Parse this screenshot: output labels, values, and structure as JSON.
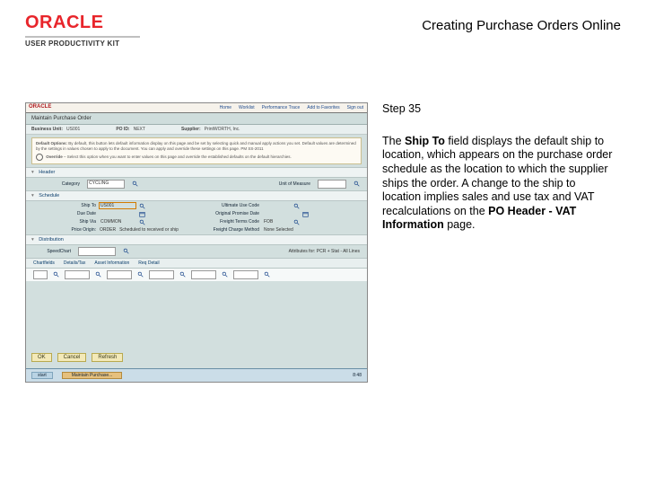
{
  "logo": {
    "brand": "ORACLE",
    "subline": "USER PRODUCTIVITY KIT"
  },
  "doc_title": "Creating Purchase Orders Online",
  "step_label": "Step 35",
  "explanation": {
    "pre": "The ",
    "bold1": "Ship To",
    "mid": " field displays the default ship to location, which appears on the purchase order schedule as the location to which the supplier ships the order. A change to the ship to location implies sales and use tax and VAT recalculations on the ",
    "bold2": "PO Header - VAT Information",
    "post": " page."
  },
  "screenshot": {
    "nav": [
      "Home",
      "Worklist",
      "Performance Trace",
      "Add to Favorites",
      "Sign out"
    ],
    "page_title": "Maintain Purchase Order",
    "info": {
      "bu_label": "Business Unit:",
      "bu_val": "US001",
      "po_label": "PO ID:",
      "po_val": "NEXT",
      "supplier_label": "Supplier:",
      "supplier_val": "PrintWORTH, Inc."
    },
    "note_title": "Default Options:",
    "note_body": "By default, this button lets default information display on this page and be set by selecting quick and manual apply actions you set. Default values are determined by the settings in values chosen to apply to the document. You can apply and override these settings on this page.\nPM SS-2011",
    "note_override": "Override",
    "note_override_body": " – Select this option when you want to enter values on this page and override the established defaults on the default hierarchies.",
    "sections": {
      "header": "Header",
      "schedule": "Schedule",
      "distribution": "Distribution"
    },
    "header_fields": {
      "category_label": "Category",
      "category_val": "CYCLING",
      "uom_label": "Unit of Measure"
    },
    "schedule_fields": {
      "shipto_label": "Ship To",
      "shipto_val": "US001",
      "distrib_label": "Ultimate Use Code",
      "duedate_label": "Due Date",
      "duedate_val": "",
      "pricedate_label": "Original Promise Date",
      "shipvia_label": "Ship Via",
      "shipvia_val": "COMMON",
      "freightcode_label": "Freight Terms Code",
      "freightcode_val": "FOB",
      "origin_label": "Price Origin:",
      "origin_val": "ORDER",
      "origin_hint": "Scheduled to received or ship",
      "process_label": "Freight Charge Method",
      "process_val": "None Selected"
    },
    "distribution_fields": {
      "speed_label": "SpeedChart",
      "right_label": "Attributes for: PCR + Stat - All Lines"
    },
    "grid": {
      "tabs": [
        "Chartfields",
        "Details/Tax",
        "Asset Information",
        "Req Detail"
      ],
      "icons": 7
    },
    "buttons": {
      "ok": "OK",
      "cancel": "Cancel",
      "refresh": "Refresh"
    },
    "taskbar": {
      "start": "start",
      "task": "Maintain Purchase...",
      "end": "8:48"
    },
    "arrow": "▾"
  }
}
